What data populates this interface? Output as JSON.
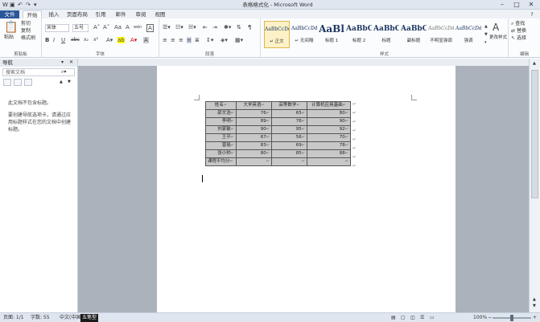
{
  "window": {
    "title": "表格格式化 - Microsoft Word",
    "minimize": "–",
    "maximize": "□",
    "close": "✕",
    "help": "?"
  },
  "quick_access": {
    "app_icon": "W",
    "save": "▣",
    "undo": "↶",
    "redo": "↷",
    "customize": "▾"
  },
  "tabs": [
    "文件",
    "开始",
    "插入",
    "页面布局",
    "引用",
    "邮件",
    "审阅",
    "视图"
  ],
  "ribbon": {
    "clipboard": {
      "label": "剪贴板",
      "paste": "粘贴",
      "cut": "剪切",
      "copy": "复制",
      "format_painter": "格式刷"
    },
    "font": {
      "label": "字体",
      "font_name": "宋体",
      "font_size": "五号",
      "bold": "B",
      "italic": "I",
      "underline": "U",
      "strike": "abc",
      "subscript": "x₂",
      "superscript": "x²",
      "grow": "A˄",
      "shrink": "A˅",
      "case": "Aa",
      "clear": "A",
      "phonetic": "wén",
      "border_char": "A"
    },
    "paragraph": {
      "label": "段落"
    },
    "styles": {
      "label": "样式",
      "items": [
        {
          "preview": "AaBbCcDd",
          "name": "↵ 正文"
        },
        {
          "preview": "AaBbCcDd",
          "name": "↵ 无间隔"
        },
        {
          "preview": "AaBl",
          "name": "标题 1"
        },
        {
          "preview": "AaBbC",
          "name": "标题 2"
        },
        {
          "preview": "AaBbC",
          "name": "标题"
        },
        {
          "preview": "AaBbC",
          "name": "副标题"
        },
        {
          "preview": "AaBbCcDd",
          "name": "不明显强调"
        },
        {
          "preview": "AaBbCcDd",
          "name": "强调"
        }
      ],
      "change_styles": "更改样式"
    },
    "editing": {
      "label": "编辑",
      "find": "查找",
      "replace": "替换",
      "select": "选择"
    }
  },
  "nav": {
    "title": "导航",
    "search_placeholder": "搜索文档",
    "msg1": "此文档不包含标题。",
    "msg2": "要创建导航选项卡，请通过应用标题样式在您的文档中创建标题。"
  },
  "table": {
    "headers": [
      "姓名",
      "大学英语",
      "高等数学",
      "计算机应用基础"
    ],
    "rows": [
      [
        "邵文浩",
        "76",
        "65",
        "80"
      ],
      [
        "李明",
        "89",
        "76",
        "90"
      ],
      [
        "刘家敏",
        "90",
        "95",
        "92"
      ],
      [
        "王平",
        "67",
        "56",
        "70"
      ],
      [
        "曾瑶",
        "83",
        "69",
        "78"
      ],
      [
        "张小帅",
        "80",
        "85",
        "88"
      ],
      [
        "课程平均分",
        "",
        "",
        ""
      ]
    ],
    "cell_mark": "↵"
  },
  "status": {
    "page": "页面: 1/1",
    "words": "字数: 55",
    "language": "中文(中国)",
    "ime": "五笔型",
    "zoom": "100%",
    "zoom_out": "−",
    "zoom_in": "+"
  }
}
